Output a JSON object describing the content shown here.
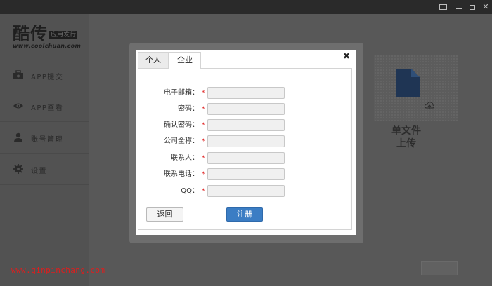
{
  "titlebar": {
    "icons": [
      "message-icon",
      "minimize-icon",
      "maximize-icon",
      "close-icon"
    ]
  },
  "logo": {
    "main": "酷传",
    "tag": "应用发行",
    "url": "www.coolchuan.com"
  },
  "sidebar": {
    "items": [
      {
        "label": "APP提交",
        "icon": "briefcase-icon"
      },
      {
        "label": "APP查看",
        "icon": "eye-icon"
      },
      {
        "label": "账号管理",
        "icon": "user-icon"
      },
      {
        "label": "设置",
        "icon": "gear-icon"
      }
    ]
  },
  "upload": {
    "label": "单文件\n上传"
  },
  "modal": {
    "tabs": [
      {
        "label": "个人",
        "active": false
      },
      {
        "label": "企业",
        "active": true
      }
    ],
    "fields": [
      {
        "label": "电子邮箱：",
        "required_mark": "*",
        "value": ""
      },
      {
        "label": "密码：",
        "required_mark": "*",
        "value": ""
      },
      {
        "label": "确认密码：",
        "required_mark": "*",
        "value": ""
      },
      {
        "label": "公司全称：",
        "required_mark": "*",
        "value": ""
      },
      {
        "label": "联系人：",
        "required_mark": "*",
        "value": ""
      },
      {
        "label": "联系电话：",
        "required_mark": "*",
        "value": ""
      },
      {
        "label": "QQ：",
        "required_mark": "*",
        "value": ""
      }
    ],
    "back_label": "返回",
    "register_label": "注册",
    "close_glyph": "✖"
  },
  "watermark": "www.qinpinchang.com",
  "colors": {
    "accent": "#3b7dc4",
    "required": "#e02222",
    "watermark": "#e01d1d"
  }
}
